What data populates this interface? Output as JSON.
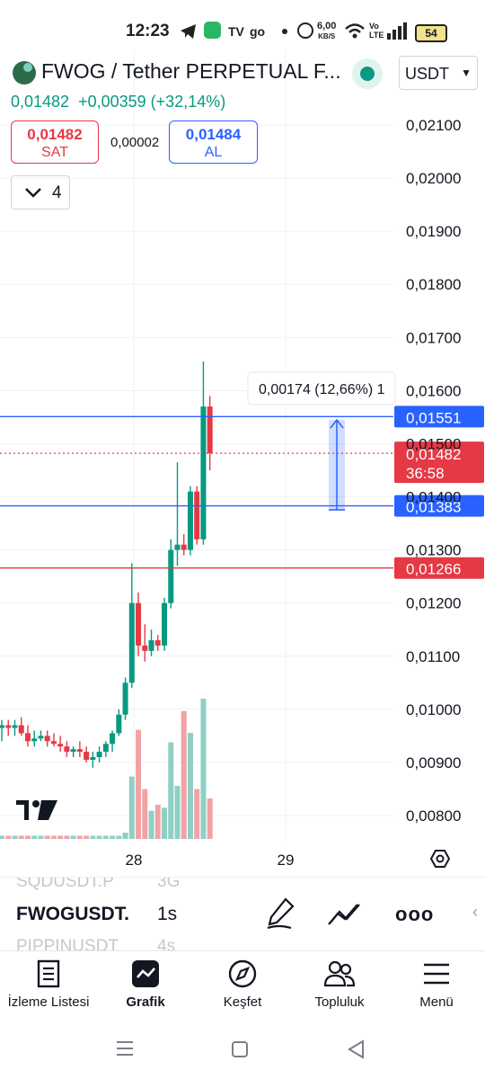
{
  "status_bar": {
    "time": "12:23",
    "network_speed": "6,00",
    "network_speed_unit": "KB/S",
    "battery": "54",
    "volte": "Vo LTE",
    "icons": [
      "telegram-icon",
      "messages-icon",
      "tradingview-icon",
      "go-icon",
      "dot-icon",
      "alarm-icon",
      "wifi-icon",
      "signal-icon",
      "battery-icon"
    ]
  },
  "header": {
    "symbol_title": "FWOG / Tether PERPETUAL F...",
    "currency": "USDT",
    "last_price": "0,01482",
    "change": "+0,00359 (+32,14%)",
    "sell": {
      "price": "0,01482",
      "label": "SAT"
    },
    "buy": {
      "price": "0,01484",
      "label": "AL"
    },
    "spread": "0,00002",
    "collapsed_count": "4"
  },
  "chart": {
    "price_axis_ticks": [
      "0,02100",
      "0,02000",
      "0,01900",
      "0,01800",
      "0,01700",
      "0,01600",
      "0,01500",
      "0,01400",
      "0,01300",
      "0,01200",
      "0,01100",
      "0,01000",
      "0,00900",
      "0,00800"
    ],
    "x_axis_labels": [
      "28",
      "29"
    ],
    "measure_label": "0,00174 (12,66%) 1",
    "lines": [
      {
        "price": "0,01551",
        "kind": "horizontal",
        "color": "#2962ff"
      },
      {
        "price": "0,01383",
        "kind": "horizontal",
        "color": "#2962ff"
      },
      {
        "price": "0,01266",
        "kind": "horizontal",
        "color": "#e53945"
      }
    ],
    "current_price": {
      "price": "0,01482",
      "countdown": "36:58",
      "color": "#e53945"
    },
    "colors": {
      "up": "#089981",
      "down": "#e53945",
      "vol_up": "#8fcfc4",
      "vol_down": "#f0a3a6",
      "blue": "#2962ff"
    }
  },
  "chart_data": {
    "type": "candlestick",
    "ylim": [
      0.0077,
      0.0215
    ],
    "candles": [
      {
        "o": 0.00965,
        "h": 0.0098,
        "l": 0.0094,
        "c": 0.0097
      },
      {
        "o": 0.0097,
        "h": 0.0098,
        "l": 0.0095,
        "c": 0.00965
      },
      {
        "o": 0.00965,
        "h": 0.0098,
        "l": 0.0095,
        "c": 0.0097
      },
      {
        "o": 0.0097,
        "h": 0.00985,
        "l": 0.0095,
        "c": 0.00955
      },
      {
        "o": 0.00955,
        "h": 0.0097,
        "l": 0.0093,
        "c": 0.0094
      },
      {
        "o": 0.0094,
        "h": 0.0096,
        "l": 0.0093,
        "c": 0.00945
      },
      {
        "o": 0.00945,
        "h": 0.0096,
        "l": 0.0094,
        "c": 0.0095
      },
      {
        "o": 0.0095,
        "h": 0.0096,
        "l": 0.0093,
        "c": 0.0094
      },
      {
        "o": 0.0094,
        "h": 0.00955,
        "l": 0.0093,
        "c": 0.00935
      },
      {
        "o": 0.00935,
        "h": 0.0095,
        "l": 0.0092,
        "c": 0.0093
      },
      {
        "o": 0.0093,
        "h": 0.0094,
        "l": 0.0091,
        "c": 0.0092
      },
      {
        "o": 0.0092,
        "h": 0.0093,
        "l": 0.0091,
        "c": 0.00925
      },
      {
        "o": 0.00925,
        "h": 0.0094,
        "l": 0.0091,
        "c": 0.0092
      },
      {
        "o": 0.0092,
        "h": 0.0093,
        "l": 0.009,
        "c": 0.00905
      },
      {
        "o": 0.00905,
        "h": 0.0092,
        "l": 0.0089,
        "c": 0.0091
      },
      {
        "o": 0.0091,
        "h": 0.0093,
        "l": 0.009,
        "c": 0.0092
      },
      {
        "o": 0.0092,
        "h": 0.0094,
        "l": 0.0091,
        "c": 0.00935
      },
      {
        "o": 0.00935,
        "h": 0.0096,
        "l": 0.0092,
        "c": 0.00955
      },
      {
        "o": 0.00955,
        "h": 0.01,
        "l": 0.0095,
        "c": 0.0099
      },
      {
        "o": 0.0099,
        "h": 0.0106,
        "l": 0.0098,
        "c": 0.0105
      },
      {
        "o": 0.0105,
        "h": 0.01275,
        "l": 0.0104,
        "c": 0.012
      },
      {
        "o": 0.012,
        "h": 0.0122,
        "l": 0.011,
        "c": 0.0112
      },
      {
        "o": 0.0112,
        "h": 0.0116,
        "l": 0.0109,
        "c": 0.0111
      },
      {
        "o": 0.0111,
        "h": 0.0115,
        "l": 0.011,
        "c": 0.0113
      },
      {
        "o": 0.0113,
        "h": 0.0114,
        "l": 0.0111,
        "c": 0.0112
      },
      {
        "o": 0.0112,
        "h": 0.0121,
        "l": 0.0111,
        "c": 0.012
      },
      {
        "o": 0.012,
        "h": 0.0132,
        "l": 0.0119,
        "c": 0.013
      },
      {
        "o": 0.013,
        "h": 0.01465,
        "l": 0.0127,
        "c": 0.0131
      },
      {
        "o": 0.0131,
        "h": 0.0133,
        "l": 0.0129,
        "c": 0.013
      },
      {
        "o": 0.013,
        "h": 0.0142,
        "l": 0.0129,
        "c": 0.0141
      },
      {
        "o": 0.0141,
        "h": 0.0142,
        "l": 0.0131,
        "c": 0.0132
      },
      {
        "o": 0.0132,
        "h": 0.01655,
        "l": 0.0131,
        "c": 0.0157
      },
      {
        "o": 0.0157,
        "h": 0.0159,
        "l": 0.0145,
        "c": 0.01482
      }
    ],
    "volume": [
      1,
      1,
      1,
      1,
      1,
      1,
      1,
      1,
      1,
      1,
      1,
      1,
      1,
      1,
      1,
      1,
      1,
      1,
      1,
      2,
      20,
      35,
      16,
      9,
      11,
      10,
      31,
      17,
      41,
      34,
      16,
      45,
      13
    ],
    "xlabels": [
      {
        "label": "28",
        "index": 20
      },
      {
        "label": "29",
        "index": 41
      }
    ]
  },
  "watchlist": {
    "rows": [
      {
        "symbol": "SQDUSDT.P",
        "interval": "3G",
        "state": "partial"
      },
      {
        "symbol": "FWOGUSDT.",
        "interval": "1s",
        "state": "selected"
      },
      {
        "symbol": "PIPPINUSDT",
        "interval": "4s",
        "state": "partial"
      }
    ]
  },
  "toolbar": {
    "icons": [
      "brush-icon",
      "trend-drawing-icon",
      "more-icon",
      "collapse-arrow-icon"
    ],
    "more_label": "ooo"
  },
  "bottom_nav": {
    "items": [
      {
        "label": "İzleme Listesi",
        "icon": "watchlist-icon"
      },
      {
        "label": "Grafik",
        "icon": "chart-icon",
        "active": true
      },
      {
        "label": "Keşfet",
        "icon": "compass-icon"
      },
      {
        "label": "Topluluk",
        "icon": "community-icon"
      },
      {
        "label": "Menü",
        "icon": "menu-icon"
      }
    ]
  },
  "gesture_bar": {
    "icons": [
      "recents-icon",
      "home-icon",
      "back-icon"
    ]
  }
}
